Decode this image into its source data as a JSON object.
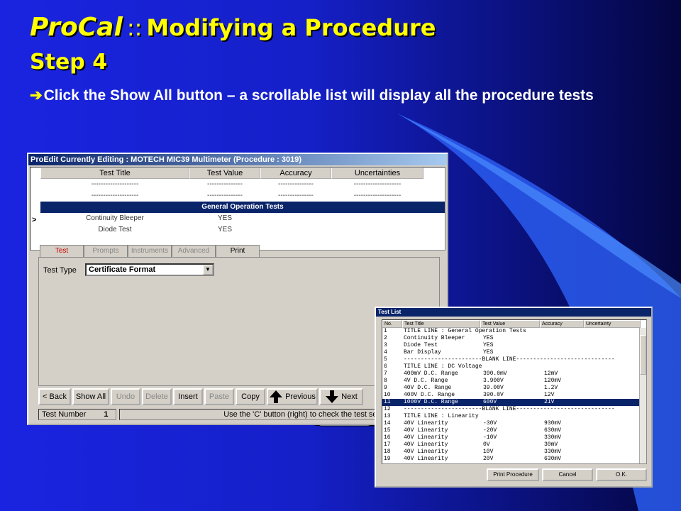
{
  "slide": {
    "title_brand": "ProCal",
    "title_sep": "::",
    "title_text": "Modifying a Procedure",
    "subtitle": "Step 4",
    "bullet_arrow": "➔",
    "bullet_text": "Click the Show All button – a scrollable list will display all the procedure tests"
  },
  "colors": {
    "accent": "#ffff00",
    "selection": "#0a246a",
    "background": "#1520c8"
  },
  "proedit": {
    "title": "ProEdit Currently Editing : MOTECH MIC39 Multimeter (Procedure : 3019)",
    "grid_headers": [
      "Test Title",
      "Test Value",
      "Accuracy",
      "Uncertainties"
    ],
    "row_pointer": ">",
    "grid_rows": [
      [
        "--------------------",
        "---------------",
        "---------------",
        "--------------------"
      ],
      [
        "--------------------",
        "---------------",
        "---------------",
        "--------------------"
      ],
      [
        "General Operation Tests"
      ],
      [
        "Continuity Bleeper",
        "YES",
        "",
        ""
      ],
      [
        "Diode Test",
        "YES",
        "",
        ""
      ]
    ],
    "tabs": [
      "Test",
      "Prompts",
      "Instruments",
      "Advanced",
      "Print"
    ],
    "test_type_label": "Test Type",
    "test_type_value": "Certificate Format",
    "buttons": {
      "back": "< Back",
      "show_all": "Show All",
      "undo": "Undo",
      "delete": "Delete",
      "insert": "Insert",
      "paste": "Paste",
      "copy": "Copy",
      "previous": "Previous",
      "next": "Next"
    },
    "status": {
      "test_number_label": "Test Number",
      "test_number_value": "1",
      "hint": "Use the 'C' button (right) to check the test settings for errors >"
    }
  },
  "testlist": {
    "title": "Test List",
    "headers": [
      "No.",
      "Test Title",
      "Test Value",
      "Accuracy",
      "Uncertainty"
    ],
    "rows": [
      [
        "1",
        "TITLE LINE : General Operation Tests",
        "",
        ""
      ],
      [
        "2",
        "Continuity Bleeper",
        "YES",
        ""
      ],
      [
        "3",
        "Diode Test",
        "YES",
        ""
      ],
      [
        "4",
        "Bar Display",
        "YES",
        ""
      ],
      [
        "5",
        "-----------------------BLANK LINE-----------------------------",
        "",
        ""
      ],
      [
        "6",
        "TITLE LINE : DC Voltage",
        "",
        ""
      ],
      [
        "7",
        "400mV D.C. Range",
        "390.0mV",
        "12mV"
      ],
      [
        "8",
        "4V D.C. Range",
        "3.900V",
        "120mV"
      ],
      [
        "9",
        "40V D.C. Range",
        "39.00V",
        "1.2V"
      ],
      [
        "10",
        "400V D.C. Range",
        "390.0V",
        "12V"
      ],
      [
        "11",
        "1000V D.C. Range",
        "600V",
        "21V"
      ],
      [
        "12",
        "-----------------------BLANK LINE-----------------------------",
        "",
        ""
      ],
      [
        "13",
        "TITLE LINE : Linearity",
        "",
        ""
      ],
      [
        "14",
        "40V Linearity",
        "-30V",
        "930mV"
      ],
      [
        "15",
        "40V Linearity",
        "-20V",
        "630mV"
      ],
      [
        "16",
        "40V Linearity",
        "-10V",
        "330mV"
      ],
      [
        "17",
        "40V Linearity",
        "0V",
        "30mV"
      ],
      [
        "18",
        "40V Linearity",
        "10V",
        "330mV"
      ],
      [
        "19",
        "40V Linearity",
        "20V",
        "630mV"
      ]
    ],
    "selected_row": "11",
    "buttons": {
      "print": "Print Procedure",
      "cancel": "Cancel",
      "ok": "O.K."
    }
  }
}
